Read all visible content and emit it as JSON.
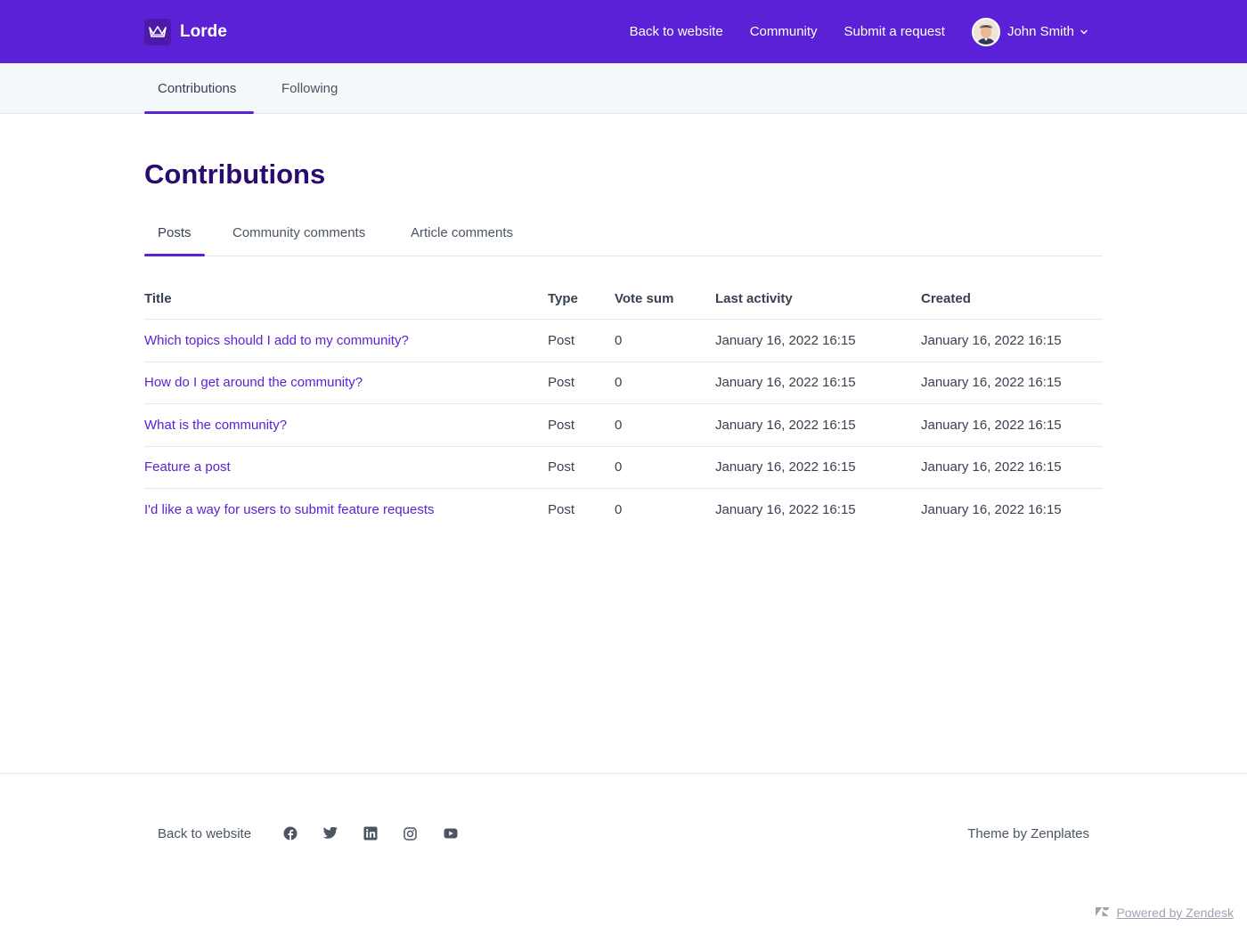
{
  "header": {
    "brand": "Lorde",
    "nav": [
      "Back to website",
      "Community",
      "Submit a request"
    ],
    "user_name": "John Smith"
  },
  "subnav": {
    "tabs": [
      {
        "label": "Contributions",
        "active": true
      },
      {
        "label": "Following",
        "active": false
      }
    ]
  },
  "page": {
    "title": "Contributions",
    "tabs": [
      {
        "label": "Posts",
        "active": true
      },
      {
        "label": "Community comments",
        "active": false
      },
      {
        "label": "Article comments",
        "active": false
      }
    ]
  },
  "table": {
    "headers": [
      "Title",
      "Type",
      "Vote sum",
      "Last activity",
      "Created"
    ],
    "rows": [
      {
        "title": "Which topics should I add to my community?",
        "type": "Post",
        "votes": "0",
        "last_activity": "January 16, 2022 16:15",
        "created": "January 16, 2022 16:15"
      },
      {
        "title": "How do I get around the community?",
        "type": "Post",
        "votes": "0",
        "last_activity": "January 16, 2022 16:15",
        "created": "January 16, 2022 16:15"
      },
      {
        "title": "What is the community?",
        "type": "Post",
        "votes": "0",
        "last_activity": "January 16, 2022 16:15",
        "created": "January 16, 2022 16:15"
      },
      {
        "title": "Feature a post",
        "type": "Post",
        "votes": "0",
        "last_activity": "January 16, 2022 16:15",
        "created": "January 16, 2022 16:15"
      },
      {
        "title": "I'd like a way for users to submit feature requests",
        "type": "Post",
        "votes": "0",
        "last_activity": "January 16, 2022 16:15",
        "created": "January 16, 2022 16:15"
      }
    ]
  },
  "footer": {
    "back_link": "Back to website",
    "social_icons": [
      "facebook-icon",
      "twitter-icon",
      "linkedin-icon",
      "instagram-icon",
      "youtube-icon"
    ],
    "theme_credit": "Theme by Zenplates",
    "powered_by": "Powered by Zendesk"
  },
  "colors": {
    "brand": "#5b21d6",
    "title": "#2a0a6e",
    "subnav_bg": "#f5f8fb"
  }
}
